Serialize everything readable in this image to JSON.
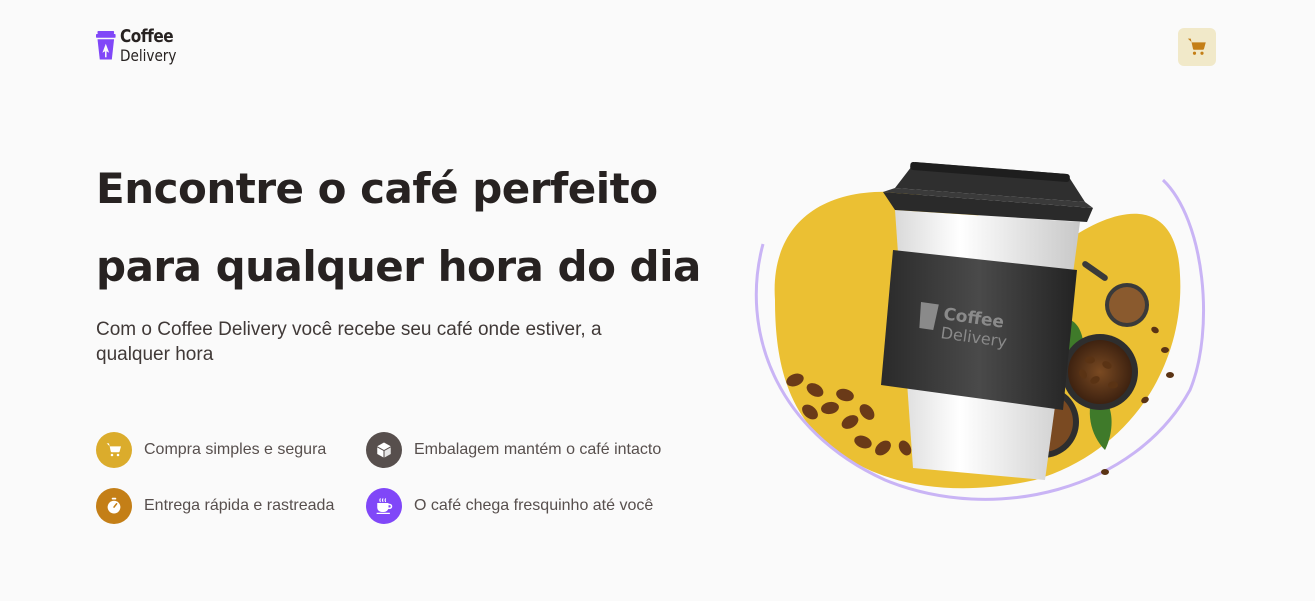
{
  "header": {
    "logo": {
      "line1": "Coffee",
      "line2": "Delivery"
    },
    "cart_icon": "shopping-cart-icon"
  },
  "hero": {
    "title_line1": "Encontre o café perfeito",
    "title_line2": "para qualquer hora do dia",
    "subtitle": "Com o Coffee Delivery você recebe seu café onde estiver, a qualquer hora",
    "image": {
      "cup_brand_line1": "Coffee",
      "cup_brand_line2": "Delivery"
    }
  },
  "features": [
    {
      "label": "Compra simples e segura",
      "icon": "shopping-cart-icon",
      "color": "#DBAC2C"
    },
    {
      "label": "Embalagem mantém o café intacto",
      "icon": "package-icon",
      "color": "#574F4D"
    },
    {
      "label": "Entrega rápida e rastreada",
      "icon": "timer-icon",
      "color": "#C47F17"
    },
    {
      "label": "O café chega fresquinho até você",
      "icon": "coffee-icon",
      "color": "#8047F8"
    }
  ],
  "colors": {
    "background": "#FAFAFA",
    "title": "#272221",
    "yellow": "#DBAC2C",
    "yellow_dark": "#C47F17",
    "yellow_light": "#F1E9C9",
    "purple": "#8047F8",
    "purple_light": "#C9B4F5",
    "brown": "#574F4D"
  }
}
